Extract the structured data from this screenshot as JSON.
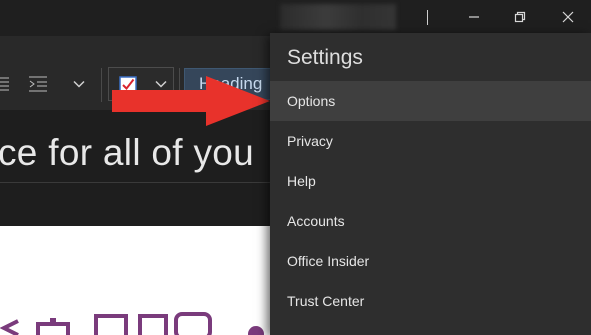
{
  "window": {
    "title": "",
    "controls": [
      "minimize",
      "restore",
      "close"
    ]
  },
  "ribbon": {
    "style_gallery_label": "Heading"
  },
  "document": {
    "headline": "ce for all of you"
  },
  "settings_menu": {
    "title": "Settings",
    "selected": "Options",
    "items": [
      {
        "label": "Options"
      },
      {
        "label": "Privacy"
      },
      {
        "label": "Help"
      },
      {
        "label": "Accounts"
      },
      {
        "label": "Office Insider"
      },
      {
        "label": "Trust Center"
      }
    ]
  },
  "colors": {
    "arrow": "#e8322b",
    "accent_purple": "#7a3b7c",
    "checkbox_mark": "#d9242f"
  },
  "icons": [
    "minimize-icon",
    "restore-icon",
    "close-icon",
    "indent-icon",
    "chevron-down-icon",
    "todo-checkbox-icon"
  ]
}
